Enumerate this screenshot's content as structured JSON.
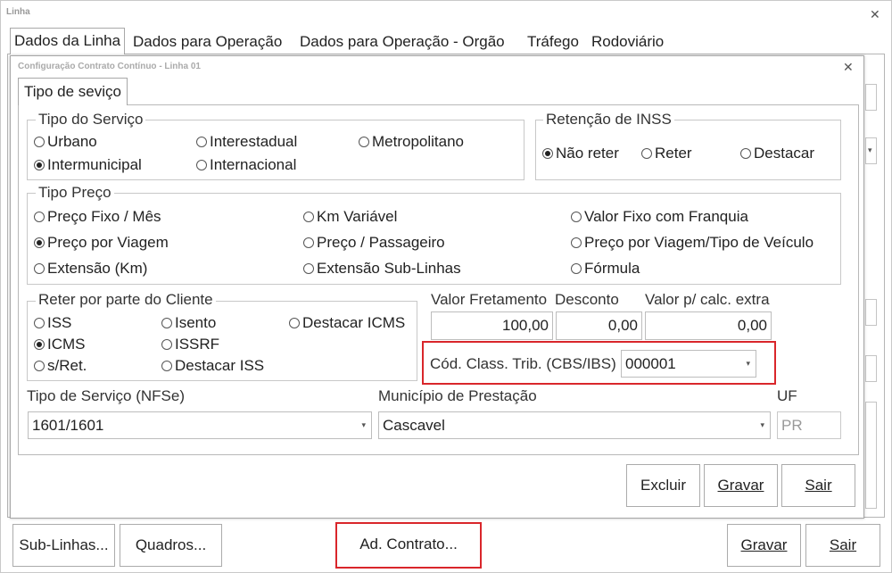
{
  "window": {
    "title": "Linha"
  },
  "tabs": [
    "Dados da Linha",
    "Dados para Operação",
    "Dados para Operação - Orgão",
    "Tráfego",
    "Rodoviário"
  ],
  "dialog": {
    "title": "Configuração Contrato Contínuo - Linha 01",
    "tab": "Tipo de seviço",
    "tipo_servico": {
      "legend": "Tipo do Serviço",
      "options": [
        "Urbano",
        "Interestadual",
        "Metropolitano",
        "Intermunicipal",
        "Internacional"
      ],
      "selected": "Intermunicipal"
    },
    "retencao_inss": {
      "legend": "Retenção de INSS",
      "options": [
        "Não reter",
        "Reter",
        "Destacar"
      ],
      "selected": "Não reter"
    },
    "tipo_preco": {
      "legend": "Tipo Preço",
      "options": [
        "Preço Fixo / Mês",
        "Km Variável",
        "Valor Fixo com Franquia",
        "Preço por Viagem",
        "Preço / Passageiro",
        "Preço por Viagem/Tipo de Veículo",
        "Extensão (Km)",
        "Extensão Sub-Linhas",
        "Fórmula"
      ],
      "selected": "Preço por Viagem"
    },
    "reter_cliente": {
      "legend": "Reter por parte do Cliente",
      "options": [
        "ISS",
        "Isento",
        "Destacar ICMS",
        "ICMS",
        "ISSRF",
        "s/Ret.",
        "Destacar ISS"
      ],
      "selected": "ICMS"
    },
    "valor_fretamento": {
      "label": "Valor Fretamento",
      "value": "100,00"
    },
    "desconto": {
      "label": "Desconto",
      "value": "0,00"
    },
    "valor_calc_extra": {
      "label": "Valor p/ calc. extra",
      "value": "0,00"
    },
    "cod_class": {
      "label": "Cód. Class. Trib. (CBS/IBS)",
      "value": "000001"
    },
    "tipo_servico_nfse": {
      "label": "Tipo de Serviço (NFSe)",
      "value": "1601/1601"
    },
    "municipio": {
      "label": "Município de Prestação",
      "value": "Cascavel"
    },
    "uf": {
      "label": "UF",
      "value": "PR"
    },
    "buttons": {
      "excluir": "Excluir",
      "gravar": "Gravar",
      "sair": "Sair"
    }
  },
  "footer": {
    "sub_linhas": "Sub-Linhas...",
    "quadros": "Quadros...",
    "ad_contrato": "Ad. Contrato...",
    "gravar": "Gravar",
    "sair": "Sair"
  },
  "colors": {
    "highlight": "#d9262b",
    "border": "#b5b5b5"
  }
}
